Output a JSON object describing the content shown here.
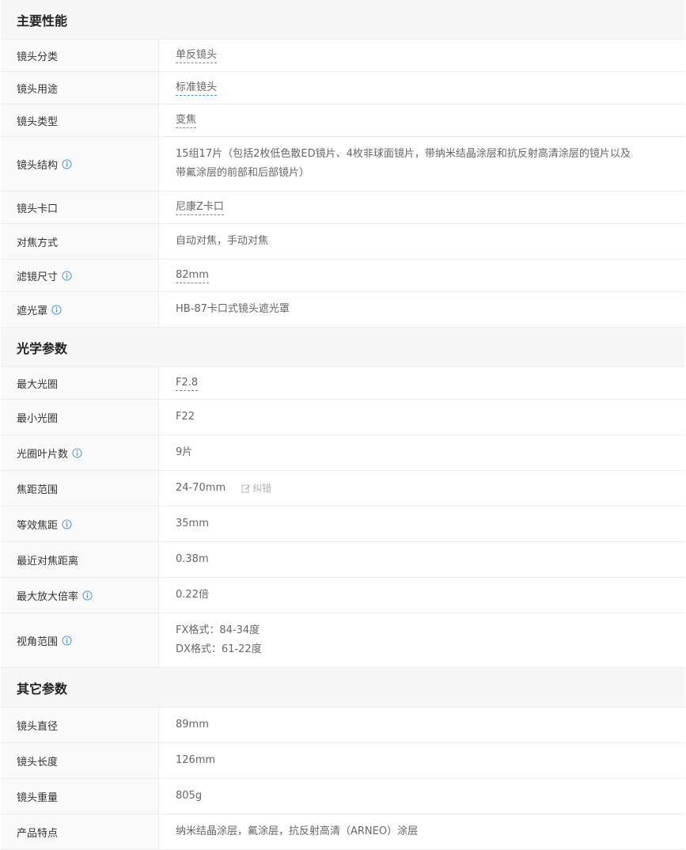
{
  "sections": [
    {
      "title": "主要性能",
      "rows": [
        {
          "label": "镜头分类",
          "value": "单反镜头",
          "link": true,
          "info": false
        },
        {
          "label": "镜头用途",
          "value": "标准镜头",
          "link": true,
          "info": false
        },
        {
          "label": "镜头类型",
          "value": "变焦",
          "link": true,
          "info": false
        },
        {
          "label": "镜头结构",
          "lines": [
            "15组17片（包括2枚低色散ED镜片、4枚非球面镜片，带纳米结晶涂层和抗反射高清涂层的镜片以及",
            "带氟涂层的前部和后部镜片）"
          ],
          "link": false,
          "info": true
        },
        {
          "label": "镜头卡口",
          "value": "尼康Z卡口",
          "link": true,
          "info": false
        },
        {
          "label": "对焦方式",
          "value": "自动对焦，手动对焦",
          "link": false,
          "info": false
        },
        {
          "label": "滤镜尺寸",
          "value": "82mm",
          "link": true,
          "info": true
        },
        {
          "label": "遮光罩",
          "value": "HB-87卡口式镜头遮光罩",
          "link": false,
          "info": true
        }
      ]
    },
    {
      "title": "光学参数",
      "rows": [
        {
          "label": "最大光圈",
          "value": "F2.8",
          "link": true,
          "info": false
        },
        {
          "label": "最小光圈",
          "value": "F22",
          "link": false,
          "info": false
        },
        {
          "label": "光圈叶片数",
          "value": "9片",
          "link": false,
          "info": true
        },
        {
          "label": "焦距范围",
          "value": "24-70mm",
          "link": false,
          "info": false,
          "correction": "纠错"
        },
        {
          "label": "等效焦距",
          "value": "35mm",
          "link": false,
          "info": true
        },
        {
          "label": "最近对焦距离",
          "value": "0.38m",
          "link": false,
          "info": false
        },
        {
          "label": "最大放大倍率",
          "value": "0.22倍",
          "link": false,
          "info": true
        },
        {
          "label": "视角范围",
          "lines": [
            "FX格式：84-34度",
            "DX格式：61-22度"
          ],
          "link": false,
          "info": true
        }
      ]
    },
    {
      "title": "其它参数",
      "rows": [
        {
          "label": "镜头直径",
          "value": "89mm",
          "link": false,
          "info": false
        },
        {
          "label": "镜头长度",
          "value": "126mm",
          "link": false,
          "info": false
        },
        {
          "label": "镜头重量",
          "value": "805g",
          "link": false,
          "info": false
        },
        {
          "label": "产品特点",
          "value": "纳米结晶涂层，氟涂层，抗反射高清（ARNEO）涂层",
          "link": false,
          "info": false
        }
      ]
    }
  ],
  "icons": {
    "info": "info-icon",
    "edit": "edit-icon"
  },
  "colors": {
    "info_icon": "#4a90d9",
    "link_underline": "#4a90d9",
    "header_bg": "#f7f7f7",
    "label_bg": "#fafafa",
    "border": "#ececec"
  }
}
